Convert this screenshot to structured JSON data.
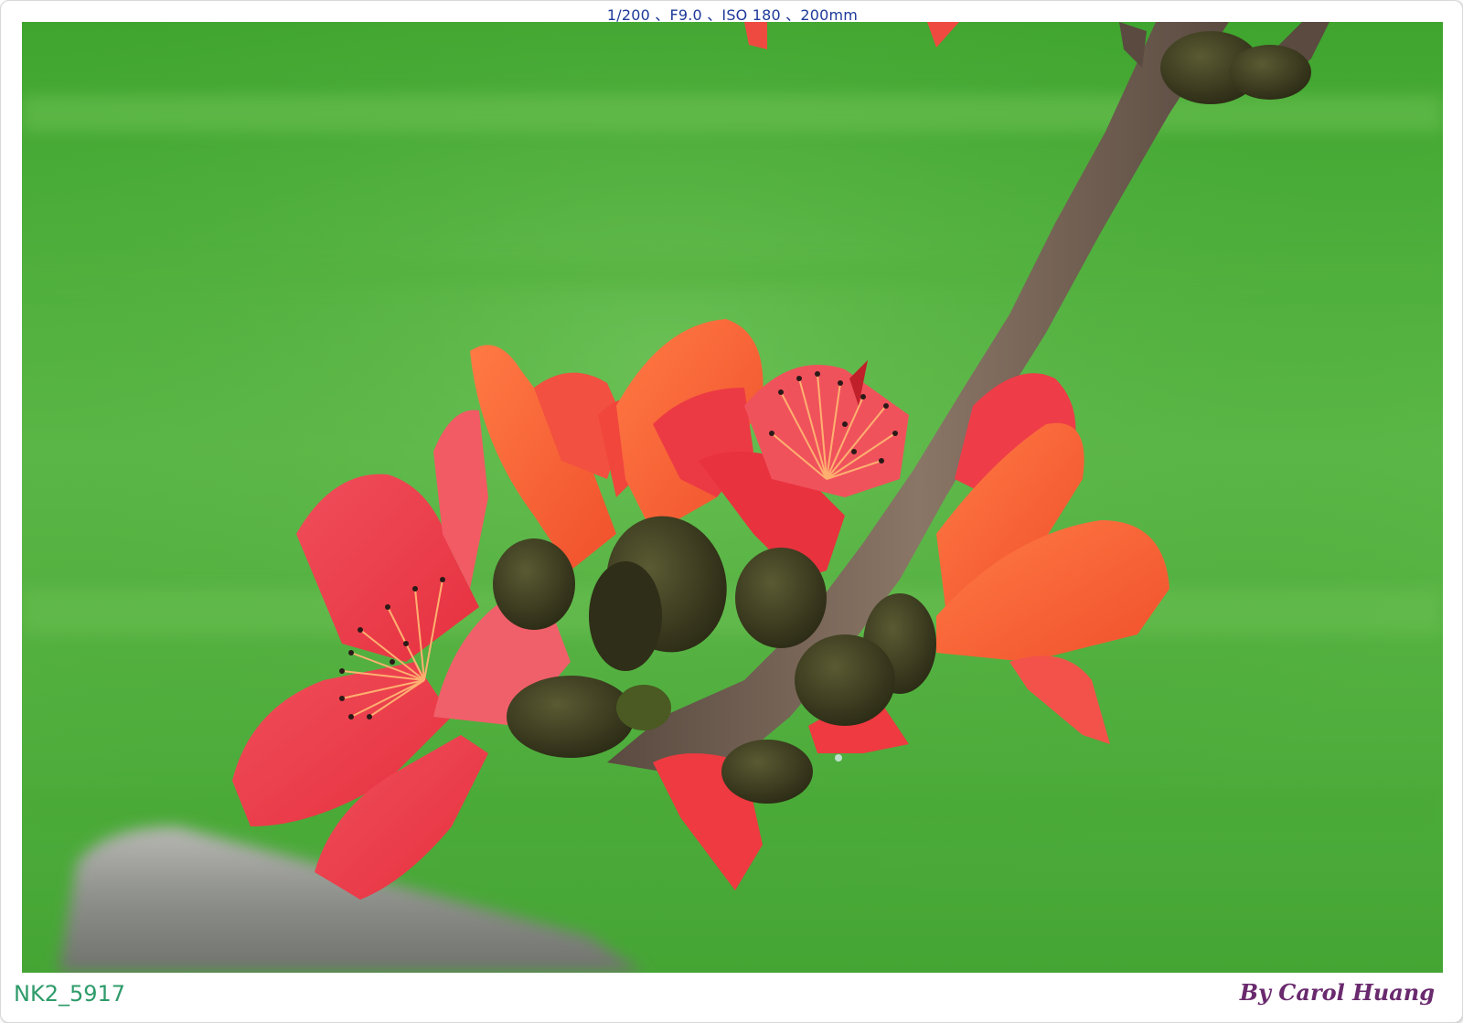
{
  "header": {
    "exif": "1/200 、F9.0 、ISO 180 、200mm"
  },
  "footer": {
    "file_id": "NK2_5917",
    "credit": "By Carol Huang"
  },
  "photo": {
    "subject": "red-cotton-tree-flower",
    "colors": {
      "background": "#4fae3c",
      "petal_red": "#f04a55",
      "petal_orange": "#ff6a3c",
      "branch": "#6e5a4e",
      "bud": "#3a3a22"
    }
  }
}
